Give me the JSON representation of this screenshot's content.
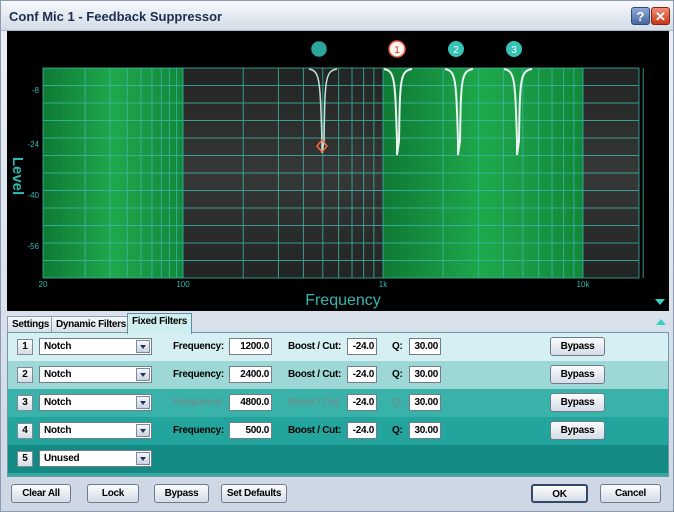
{
  "window": {
    "title": "Conf Mic 1 - Feedback Suppressor"
  },
  "titlebar": {
    "help_label": "?",
    "close_label": "✕"
  },
  "graph": {
    "y_label": "Level",
    "x_label": "Frequency",
    "y_ticks": [
      "-8",
      "-24",
      "-40",
      "-56"
    ],
    "x_ticks": [
      "20",
      "100",
      "1k",
      "10k"
    ],
    "markers": [
      "",
      "1",
      "2",
      "3"
    ],
    "colors": {
      "green_band": "#1a9440",
      "dark_band": "#2a2c2b",
      "grid": "#39b3a6",
      "label": "#2fb8b2"
    }
  },
  "tabs": [
    {
      "label": "Settings",
      "active": false
    },
    {
      "label": "Dynamic Filters",
      "active": false
    },
    {
      "label": "Fixed Filters",
      "active": true
    }
  ],
  "rows": [
    {
      "num": "1",
      "type": "Notch",
      "freq_label": "Frequency:",
      "freq": "1200.0",
      "boost_label": "Boost / Cut:",
      "boost": "-24.0",
      "q_label": "Q:",
      "q": "30.00",
      "bypass": "Bypass",
      "bg": "#d6eff2",
      "dim": false
    },
    {
      "num": "2",
      "type": "Notch",
      "freq_label": "Frequency:",
      "freq": "2400.0",
      "boost_label": "Boost / Cut:",
      "boost": "-24.0",
      "q_label": "Q:",
      "q": "30.00",
      "bypass": "Bypass",
      "bg": "#9dd8d6",
      "dim": false
    },
    {
      "num": "3",
      "type": "Notch",
      "freq_label": "Frequency:",
      "freq": "4800.0",
      "boost_label": "Boost / Cut:",
      "boost": "-24.0",
      "q_label": "Q:",
      "q": "30.00",
      "bypass": "Bypass",
      "bg": "#39b2aa",
      "dim": true
    },
    {
      "num": "4",
      "type": "Notch",
      "freq_label": "Frequency:",
      "freq": "500.0",
      "boost_label": "Boost / Cut:",
      "boost": "-24.0",
      "q_label": "Q:",
      "q": "30.00",
      "bypass": "Bypass",
      "bg": "#23a49c",
      "dim": false
    },
    {
      "num": "5",
      "type": "Unused",
      "bg": "#138a84"
    }
  ],
  "buttons": {
    "clear_all": "Clear All",
    "lock": "Lock",
    "bypass": "Bypass",
    "set_defaults": "Set Defaults",
    "ok": "OK",
    "cancel": "Cancel"
  }
}
